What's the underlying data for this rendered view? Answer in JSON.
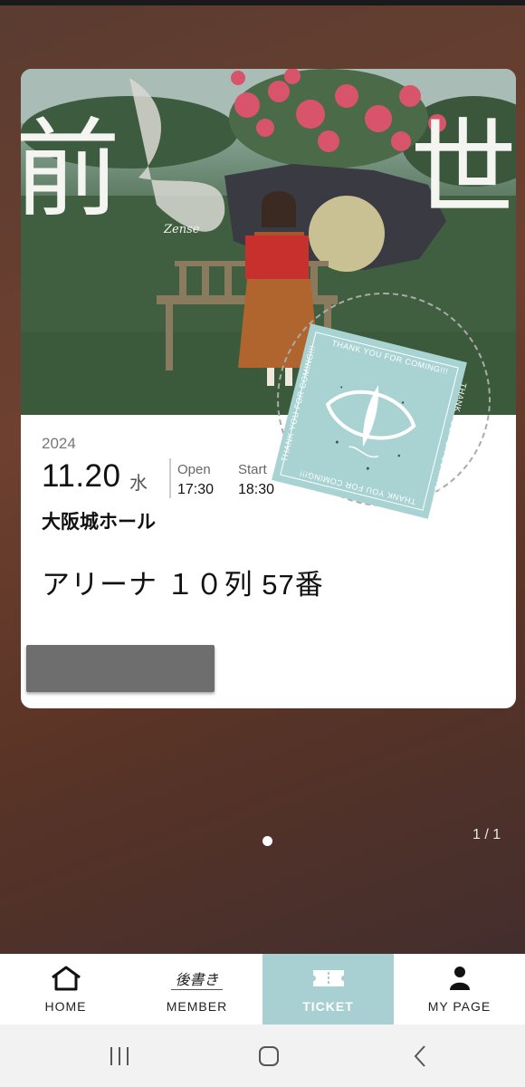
{
  "ticket": {
    "art": {
      "title_left": "前",
      "title_right": "世",
      "subtitle": "Zense",
      "stamp_text": "THANK YOU FOR COMING!!!"
    },
    "year": "2024",
    "date": "11.20",
    "weekday": "水",
    "open_label": "Open",
    "open_time": "17:30",
    "start_label": "Start",
    "start_time": "18:30",
    "venue": "大阪城ホール",
    "seat": "アリーナ １０列 57番"
  },
  "pager": {
    "counter": "1 / 1"
  },
  "bottom_nav": {
    "items": [
      {
        "label": "HOME",
        "icon": "home-icon"
      },
      {
        "label": "MEMBER",
        "icon": "member-logo-icon",
        "logo_text": "後書き"
      },
      {
        "label": "TICKET",
        "icon": "ticket-icon",
        "active": true
      },
      {
        "label": "MY PAGE",
        "icon": "person-icon"
      }
    ]
  },
  "colors": {
    "accent": "#a8cfd2",
    "background_top": "#5a3c30",
    "background_bottom": "#3b2c30"
  }
}
